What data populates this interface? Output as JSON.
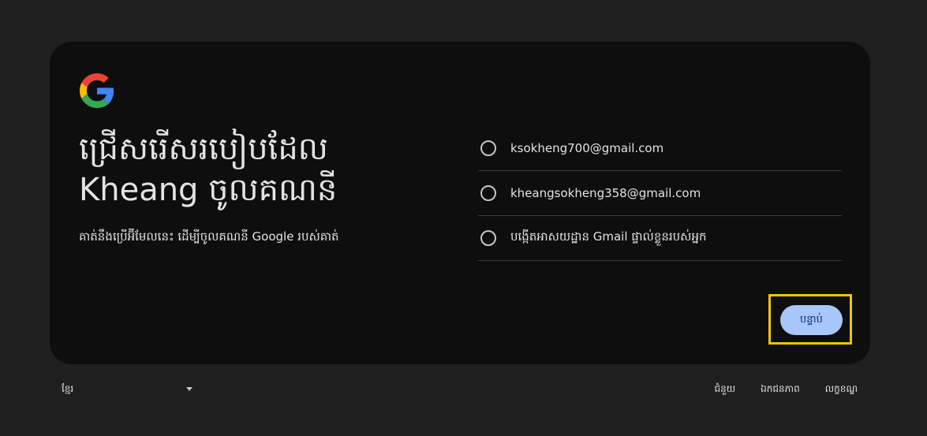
{
  "card": {
    "title_line1": "ជ្រើសរើសរបៀបដែល",
    "title_line2": "Kheang ចូលគណនី",
    "subtitle": "គាត់នឹងប្រើអ៊ីមែលនេះ ដើម្បីចូលគណនី Google របស់គាត់",
    "options": [
      {
        "label": "ksokheng700@gmail.com"
      },
      {
        "label": "kheangsokheng358@gmail.com"
      },
      {
        "label": "បង្កើតអាសយដ្ឋាន Gmail ផ្ទាល់ខ្លួនរបស់អ្នក"
      }
    ],
    "next_label": "បន្ទាប់"
  },
  "footer": {
    "language": "ខ្មែរ",
    "links": [
      "ជំនួយ",
      "ឯកជនភាព",
      "លក្ខខណ្ឌ"
    ]
  },
  "colors": {
    "page_bg": "#1f1f1f",
    "card_bg": "#0e0e0e",
    "button_bg": "#a8c7fa",
    "highlight": "#f4c20d"
  },
  "icons": {
    "logo": "google-logo",
    "radio": "radio-unchecked-icon",
    "dropdown": "chevron-down-icon"
  }
}
